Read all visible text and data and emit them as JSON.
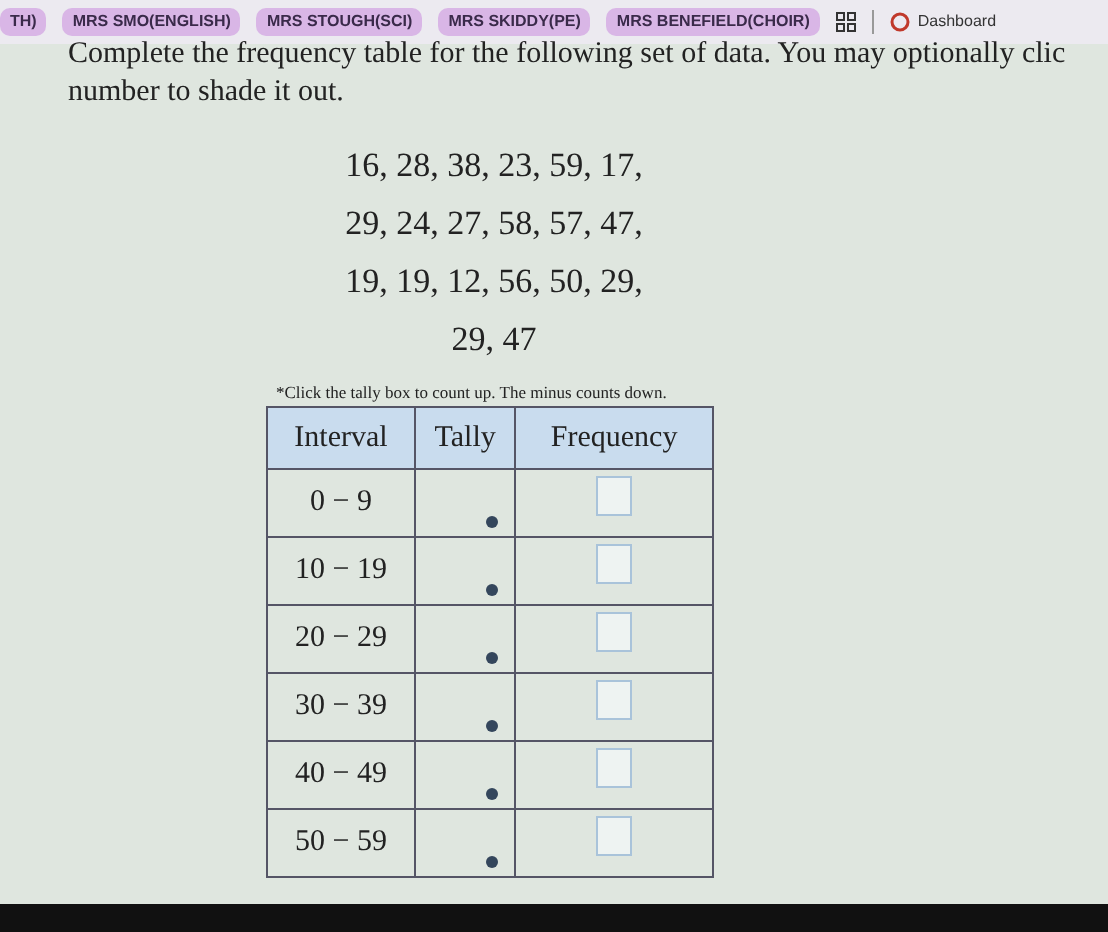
{
  "bookmarks": [
    {
      "label": "TH)"
    },
    {
      "label": "MRS SMO(ENGLISH)"
    },
    {
      "label": "MRS STOUGH(SCI)"
    },
    {
      "label": "MRS SKIDDY(PE)"
    },
    {
      "label": "MRS BENEFIELD(CHOIR)"
    }
  ],
  "dashboard": {
    "label": "Dashboard"
  },
  "instructions": [
    "Complete the frequency table for the following set of data. You may optionally clic",
    "number to shade it out."
  ],
  "data_lines": [
    "16, 28, 38, 23, 59, 17,",
    "29, 24, 27, 58, 57, 47,",
    "19, 19, 12, 56, 50, 29,",
    "29, 47"
  ],
  "note": "*Click the tally box to count up. The minus counts down.",
  "table": {
    "columns": [
      "Interval",
      "Tally",
      "Frequency"
    ],
    "rows": [
      {
        "interval": "0 − 9"
      },
      {
        "interval": "10 − 19"
      },
      {
        "interval": "20 − 29"
      },
      {
        "interval": "30 − 39"
      },
      {
        "interval": "40 − 49"
      },
      {
        "interval": "50 − 59"
      }
    ]
  }
}
